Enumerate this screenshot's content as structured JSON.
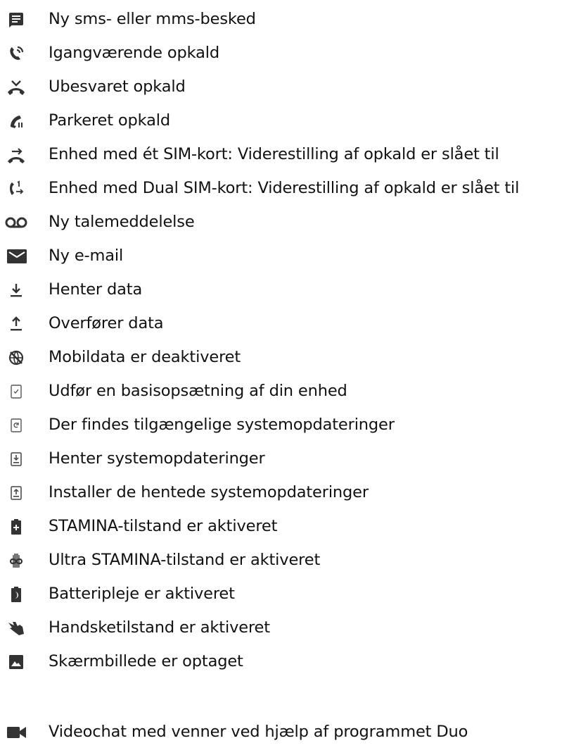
{
  "colors": {
    "icon": "#333333",
    "text": "#111111",
    "background": "#ffffff"
  },
  "items": [
    {
      "icon": "message-icon",
      "label": "Ny sms- eller mms-besked"
    },
    {
      "icon": "call-ongoing-icon",
      "label": "Igangværende opkald"
    },
    {
      "icon": "missed-call-icon",
      "label": "Ubesvaret opkald"
    },
    {
      "icon": "call-on-hold-icon",
      "label": "Parkeret opkald"
    },
    {
      "icon": "call-forward-icon",
      "label": "Enhed med ét SIM-kort: Viderestilling af opkald er slået til"
    },
    {
      "icon": "dual-sim-call-forward-icon",
      "label": "Enhed med Dual SIM-kort: Viderestilling af opkald er slået til"
    },
    {
      "icon": "voicemail-icon",
      "label": "Ny talemeddelelse"
    },
    {
      "icon": "email-icon",
      "label": "Ny e-mail"
    },
    {
      "icon": "download-icon",
      "label": "Henter data"
    },
    {
      "icon": "upload-icon",
      "label": "Overfører data"
    },
    {
      "icon": "mobile-data-off-icon",
      "label": "Mobildata er deaktiveret"
    },
    {
      "icon": "device-setup-icon",
      "label": "Udfør en basisopsætning af din enhed"
    },
    {
      "icon": "system-update-available-icon",
      "label": "Der findes tilgængelige systemopdateringer"
    },
    {
      "icon": "system-update-download-icon",
      "label": "Henter systemopdateringer"
    },
    {
      "icon": "system-update-install-icon",
      "label": "Installer de hentede systemopdateringer"
    },
    {
      "icon": "stamina-battery-icon",
      "label": "STAMINA-tilstand er aktiveret"
    },
    {
      "icon": "ultra-stamina-icon",
      "label": "Ultra STAMINA-tilstand er aktiveret"
    },
    {
      "icon": "battery-care-icon",
      "label": "Batteripleje er aktiveret"
    },
    {
      "icon": "glove-mode-icon",
      "label": "Handsketilstand er aktiveret"
    },
    {
      "icon": "screenshot-icon",
      "label": "Skærmbillede er optaget"
    },
    {
      "icon": "video-chat-icon",
      "label": "Videochat med venner ved hjælp af programmet Duo"
    }
  ]
}
